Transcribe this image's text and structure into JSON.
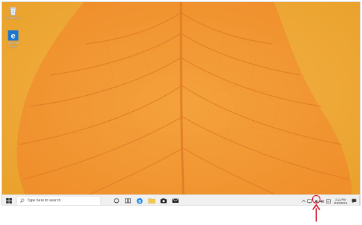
{
  "desktop": {
    "icons": [
      {
        "label": "Recycle Bin",
        "icon": "recycle-bin-icon"
      },
      {
        "label": "Microsoft Edge",
        "icon": "edge-icon"
      }
    ],
    "wallpaper": {
      "subject": "orange leaf veins",
      "base_color": "#f0a13a",
      "vein_color": "#e5852a"
    }
  },
  "taskbar": {
    "start_icon": "windows-logo-icon",
    "search_placeholder": "Type here to search",
    "pinned": [
      {
        "name": "cortana",
        "icon": "cortana-circle-icon"
      },
      {
        "name": "task-view",
        "icon": "task-view-icon"
      },
      {
        "name": "edge",
        "icon": "edge-icon"
      },
      {
        "name": "file-explorer",
        "icon": "folder-icon"
      },
      {
        "name": "camera",
        "icon": "camera-icon"
      },
      {
        "name": "mail",
        "icon": "mail-icon"
      }
    ],
    "tray": {
      "icons": [
        "chevron-up-icon",
        "network-icon",
        "highlighted-tray-icon",
        "volume-icon",
        "language-icon"
      ],
      "time": "3:11 PM",
      "date": "3/10/2021"
    },
    "notification_icon": "notification-icon"
  },
  "annotation": {
    "color": "#d0021b",
    "marker": "red-arrow"
  }
}
